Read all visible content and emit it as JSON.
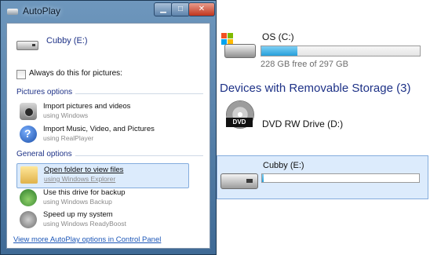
{
  "autoplay": {
    "window_title": "AutoPlay",
    "device_name": "Cubby (E:)",
    "checkbox_label": "Always do this for pictures:",
    "checkbox_checked": false,
    "sections": {
      "pictures": "Pictures options",
      "general": "General options"
    },
    "options": [
      {
        "title": "Import pictures and videos",
        "subtitle": "using Windows",
        "icon": "camera-icon"
      },
      {
        "title": "Import Music, Video, and Pictures",
        "subtitle": "using RealPlayer",
        "icon": "realplayer-icon"
      },
      {
        "title": "Open folder to view files",
        "subtitle": "using Windows Explorer",
        "icon": "folder-icon",
        "selected": true
      },
      {
        "title": "Use this drive for backup",
        "subtitle": "using Windows Backup",
        "icon": "backup-icon"
      },
      {
        "title": "Speed up my system",
        "subtitle": "using Windows ReadyBoost",
        "icon": "readyboost-icon"
      }
    ],
    "control_panel_link": "View more AutoPlay options in Control Panel"
  },
  "explorer": {
    "os_drive": {
      "name": "OS (C:)",
      "free_text": "228 GB free of 297 GB",
      "used_fraction": 0.23
    },
    "removable_header": "Devices with Removable Storage (3)",
    "dvd_drive": {
      "name": "DVD RW Drive (D:)",
      "badge": "DVD"
    },
    "cubby_drive": {
      "name": "Cubby (E:)",
      "used_fraction": 0.01
    }
  },
  "colors": {
    "link_blue": "#1e3287",
    "selection_fill": "#dcebfc",
    "selection_border": "#84acdd",
    "bar_fill": "#26a0da"
  }
}
